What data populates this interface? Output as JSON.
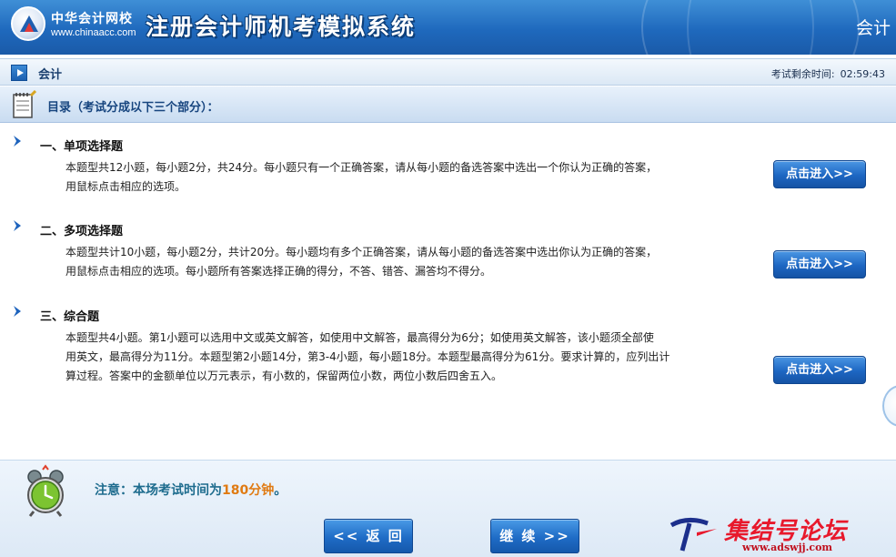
{
  "header": {
    "brand_name": "中华会计网校",
    "brand_url": "www.chinaacc.com",
    "app_title": "注册会计师机考模拟系统",
    "subject": "会计"
  },
  "subbar": {
    "subject": "会计",
    "timer_label": "考试剩余时间:",
    "timer_value": "02:59:43"
  },
  "toc": {
    "title": "目录（考试分成以下三个部分）："
  },
  "sections": [
    {
      "heading": "一、单项选择题",
      "desc_lines": [
        "本题型共12小题，每小题2分，共24分。每小题只有一个正确答案，请从每小题的备选答案中选出一个你认为正确的答案，",
        "用鼠标点击相应的选项。"
      ],
      "button": "点击进入>>"
    },
    {
      "heading": "二、多项选择题",
      "desc_lines": [
        "本题型共计10小题，每小题2分，共计20分。每小题均有多个正确答案，请从每小题的备选答案中选出你认为正确的答案，",
        "用鼠标点击相应的选项。每小题所有答案选择正确的得分，不答、错答、漏答均不得分。"
      ],
      "button": "点击进入>>"
    },
    {
      "heading": "三、综合题",
      "desc_lines": [
        "本题型共4小题。第1小题可以选用中文或英文解答，如使用中文解答，最高得分为6分；如使用英文解答，该小题须全部使",
        "用英文，最高得分为11分。本题型第2小题14分，第3-4小题，每小题18分。本题型最高得分为61分。要求计算的，应列出计",
        "算过程。答案中的金额单位以万元表示，有小数的，保留两位小数，两位小数后四舍五入。"
      ],
      "button": "点击进入>>"
    }
  ],
  "notice": {
    "prefix": "注意：本场考试时间为",
    "minutes": "180分钟",
    "suffix": "。"
  },
  "nav": {
    "back": "<< 返 回",
    "next": "继 续 >>"
  },
  "watermark": {
    "title": "集结号论坛",
    "url": "www.adswjj.com"
  },
  "colors": {
    "header_blue": "#1f69bd",
    "button_blue": "#1d66c2",
    "notice_teal": "#1e6c8e",
    "notice_orange": "#e07a12",
    "watermark_red": "#e8192c"
  }
}
